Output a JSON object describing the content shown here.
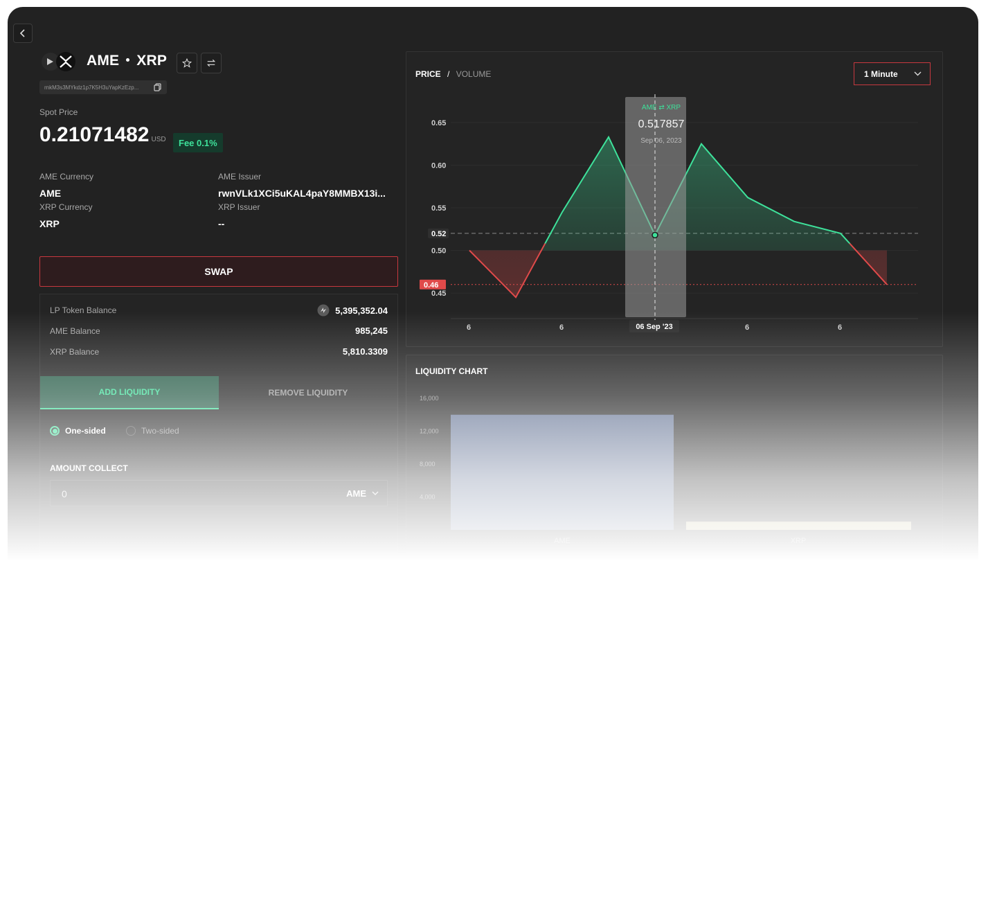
{
  "pair": {
    "base": "AME",
    "quote": "XRP"
  },
  "pool_address": "rnkM3s3MYkdz1p7K5H3uYapKzEzp...",
  "spot_price": {
    "label": "Spot Price",
    "value": "0.21071482",
    "unit": "USD"
  },
  "fee": "Fee 0.1%",
  "details": [
    {
      "label": "AME Currency",
      "value": "AME"
    },
    {
      "label": "AME Issuer",
      "value": "rwnVLk1XCi5uKAL4paY8MMBX13i..."
    },
    {
      "label": "XRP Currency",
      "value": "XRP"
    },
    {
      "label": "XRP Issuer",
      "value": "--"
    }
  ],
  "swap_label": "SWAP",
  "balances": [
    {
      "label": "LP Token Balance",
      "value": "5,395,352.04"
    },
    {
      "label": "AME Balance",
      "value": "985,245"
    },
    {
      "label": "XRP Balance",
      "value": "5,810.3309"
    }
  ],
  "liquidity_tabs": {
    "add": "ADD LIQUIDITY",
    "remove": "REMOVE LIQUIDITY",
    "active": "add"
  },
  "sides": {
    "one": "One-sided",
    "two": "Two-sided",
    "selected": "one"
  },
  "amount": {
    "label": "AMOUNT COLLECT",
    "value": "0",
    "token": "AME"
  },
  "price_chart": {
    "tab_price": "PRICE",
    "separator": "/",
    "tab_volume": "VOLUME",
    "interval": "1 Minute",
    "tooltip": {
      "pair": "AME ⇄ XRP",
      "value": "0.517857",
      "date": "Sep 06, 2023"
    },
    "crosshair_x_label": "06 Sep '23",
    "current_price_label": "0.52",
    "open_price_label": "0.46"
  },
  "liquidity_chart": {
    "title": "LIQUIDITY CHART"
  },
  "colors": {
    "up": "#3ee29b",
    "down": "#e04a4a",
    "accent_red": "#c8383f",
    "bg": "#222222"
  },
  "chart_data": [
    {
      "type": "line",
      "x_ticks": [
        "6",
        "6",
        "06 Sep '23",
        "6",
        "6"
      ],
      "y_ticks": [
        "0.65",
        "0.60",
        "0.55",
        "0.52",
        "0.50",
        "0.46",
        "0.45"
      ],
      "ylim": [
        0.42,
        0.68
      ],
      "baseline": 0.46,
      "current": 0.52,
      "values": [
        0.5,
        0.445,
        0.545,
        0.633,
        0.518,
        0.625,
        0.562,
        0.534,
        0.52,
        0.46
      ],
      "highlight_index": 4,
      "grid": true
    },
    {
      "type": "bar",
      "title": "LIQUIDITY CHART",
      "categories": [
        "AME",
        "XRP"
      ],
      "values": [
        14000,
        1000
      ],
      "y_ticks": [
        "16,000",
        "12,000",
        "8,000",
        "4,000"
      ],
      "ylim": [
        0,
        16000
      ]
    }
  ]
}
